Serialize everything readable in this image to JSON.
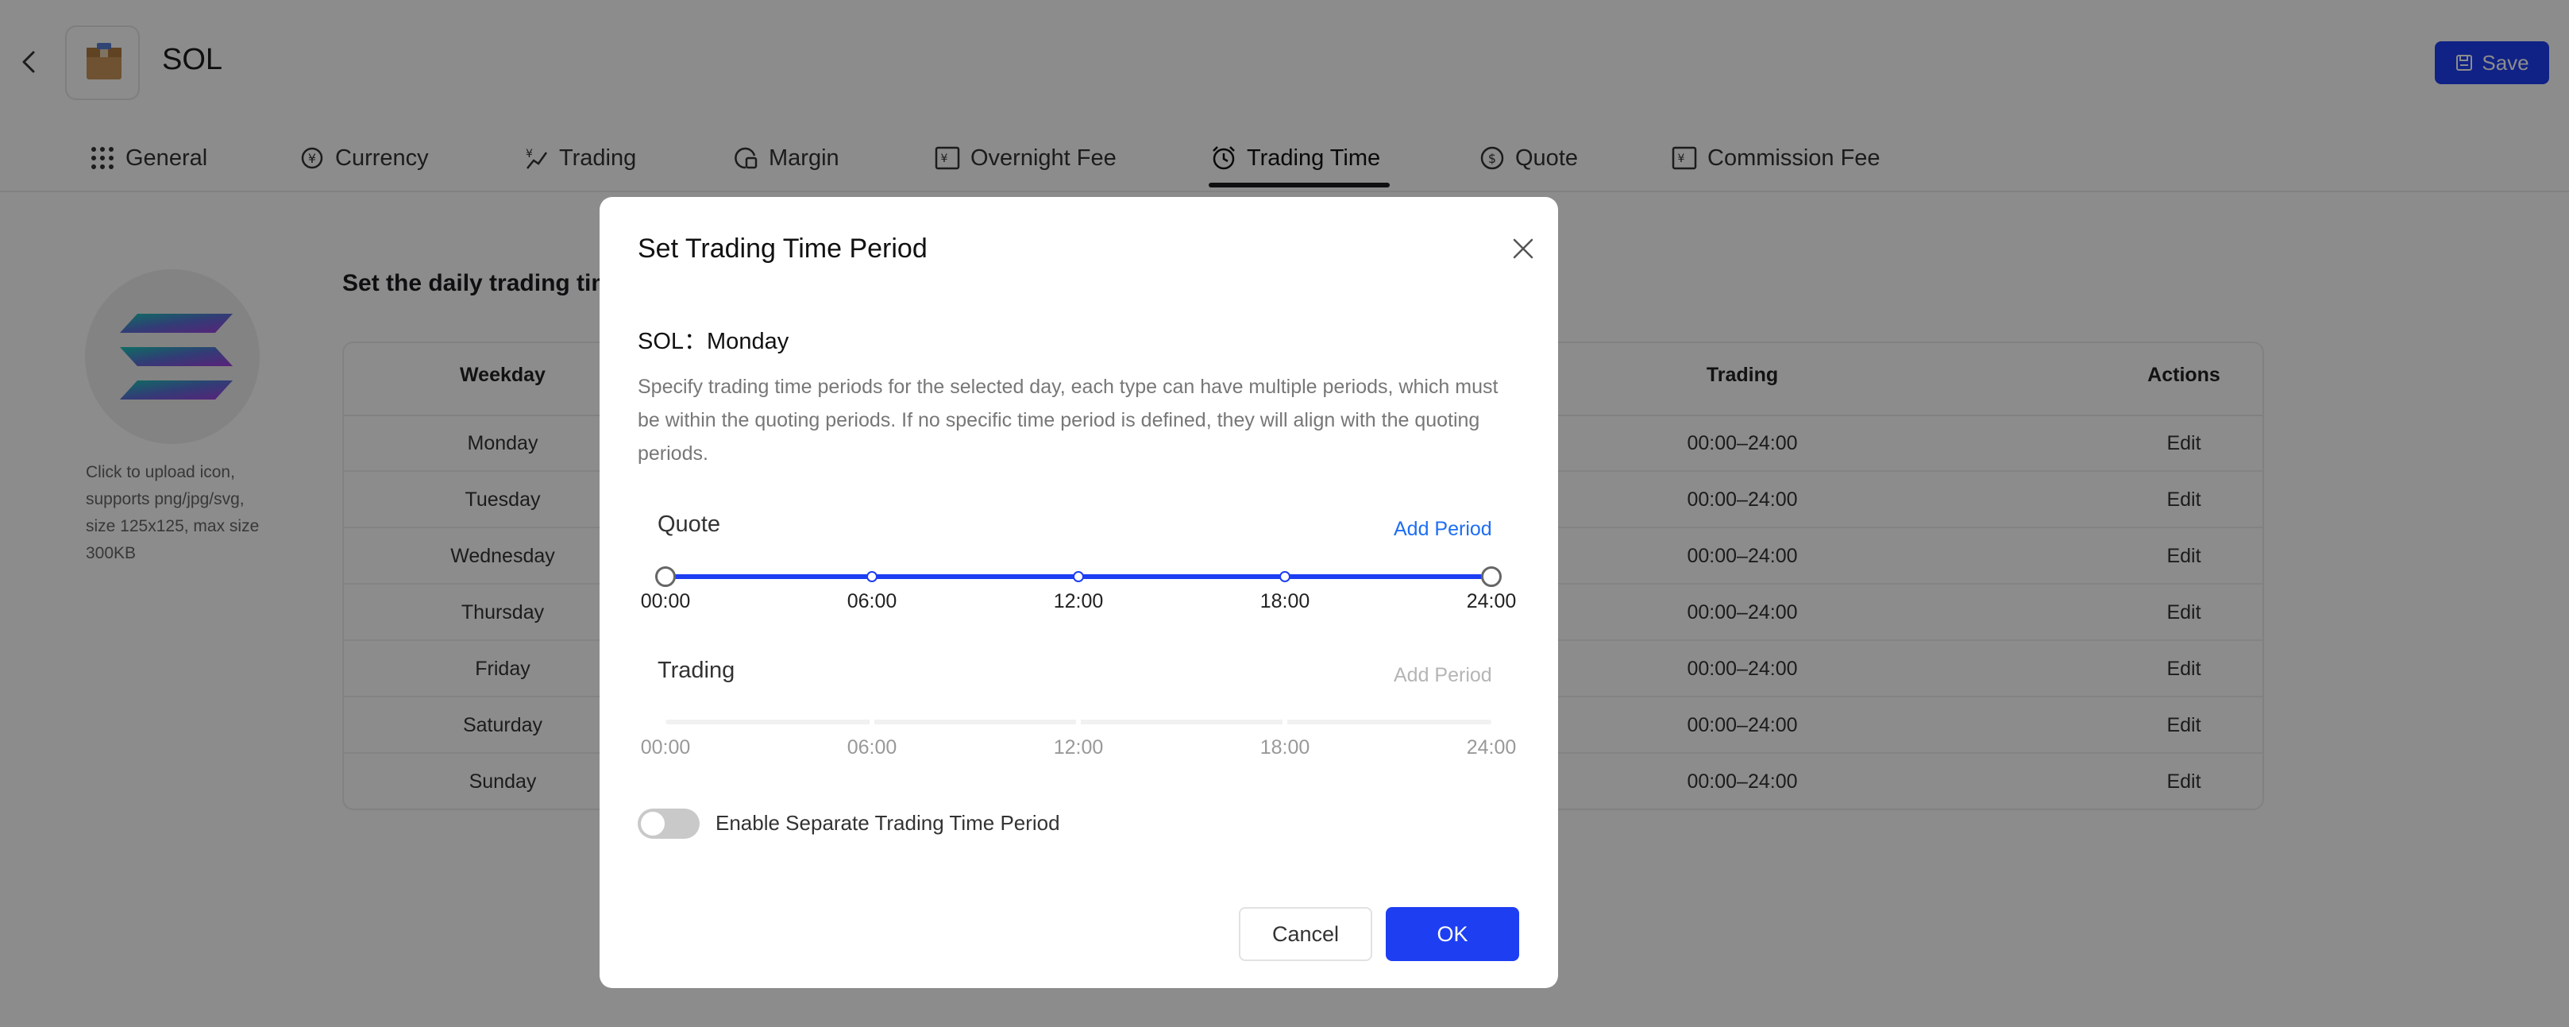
{
  "header": {
    "asset_name": "SOL",
    "save_label": "Save"
  },
  "tabs": [
    {
      "label": "General",
      "icon": "grid-icon"
    },
    {
      "label": "Currency",
      "icon": "currency-exchange-icon"
    },
    {
      "label": "Trading",
      "icon": "trading-icon"
    },
    {
      "label": "Margin",
      "icon": "margin-icon"
    },
    {
      "label": "Overnight Fee",
      "icon": "overnight-fee-icon"
    },
    {
      "label": "Trading Time",
      "icon": "clock-icon",
      "active": true
    },
    {
      "label": "Quote",
      "icon": "quote-icon"
    },
    {
      "label": "Commission Fee",
      "icon": "commission-fee-icon"
    }
  ],
  "sidebar": {
    "upload_hint": "Click to upload icon, supports png/jpg/svg, size 125x125, max size 300KB"
  },
  "main": {
    "section_title": "Set the daily trading time",
    "table": {
      "columns": {
        "weekday": "Weekday",
        "trading": "Trading",
        "actions": "Actions"
      },
      "rows": [
        {
          "weekday": "Monday",
          "trading": "00:00–24:00",
          "action": "Edit"
        },
        {
          "weekday": "Tuesday",
          "trading": "00:00–24:00",
          "action": "Edit"
        },
        {
          "weekday": "Wednesday",
          "trading": "00:00–24:00",
          "action": "Edit"
        },
        {
          "weekday": "Thursday",
          "trading": "00:00–24:00",
          "action": "Edit"
        },
        {
          "weekday": "Friday",
          "trading": "00:00–24:00",
          "action": "Edit"
        },
        {
          "weekday": "Saturday",
          "trading": "00:00–24:00",
          "action": "Edit"
        },
        {
          "weekday": "Sunday",
          "trading": "00:00–24:00",
          "action": "Edit"
        }
      ]
    }
  },
  "modal": {
    "title": "Set Trading Time Period",
    "subtitle": "SOL：Monday",
    "description": "Specify trading time periods for the selected day, each type can have multiple periods, which must be within the quoting periods. If no specific time period is defined, they will align with the quoting periods.",
    "quote": {
      "label": "Quote",
      "add_period": "Add Period",
      "range_start": 0,
      "range_end": 1,
      "ticks": [
        "00:00",
        "06:00",
        "12:00",
        "18:00",
        "24:00"
      ]
    },
    "trading": {
      "label": "Trading",
      "add_period": "Add Period",
      "ticks": [
        "00:00",
        "06:00",
        "12:00",
        "18:00",
        "24:00"
      ]
    },
    "toggle": {
      "label": "Enable Separate Trading Time Period",
      "enabled": false
    },
    "cancel_label": "Cancel",
    "ok_label": "OK"
  },
  "colors": {
    "primary": "#1e3ef2",
    "link": "#1e6ef2",
    "overlay": "rgba(0,0,0,0.45)"
  }
}
